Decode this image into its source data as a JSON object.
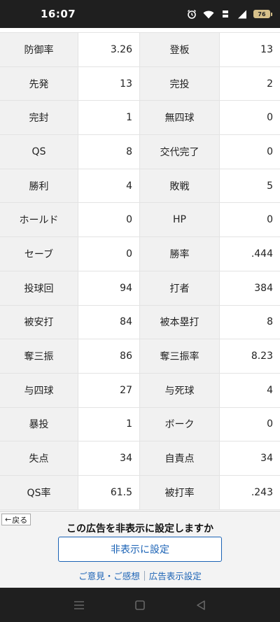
{
  "status_bar": {
    "time": "16:07",
    "battery_level": "76",
    "icons": [
      "alarm-icon",
      "wifi-icon",
      "volte-icon",
      "signal-icon",
      "battery-icon"
    ]
  },
  "stats": [
    {
      "l1": "防御率",
      "v1": "3.26",
      "l2": "登板",
      "v2": "13"
    },
    {
      "l1": "先発",
      "v1": "13",
      "l2": "完投",
      "v2": "2"
    },
    {
      "l1": "完封",
      "v1": "1",
      "l2": "無四球",
      "v2": "0"
    },
    {
      "l1": "QS",
      "v1": "8",
      "l2": "交代完了",
      "v2": "0"
    },
    {
      "l1": "勝利",
      "v1": "4",
      "l2": "敗戦",
      "v2": "5"
    },
    {
      "l1": "ホールド",
      "v1": "0",
      "l2": "HP",
      "v2": "0"
    },
    {
      "l1": "セーブ",
      "v1": "0",
      "l2": "勝率",
      "v2": ".444"
    },
    {
      "l1": "投球回",
      "v1": "94",
      "l2": "打者",
      "v2": "384"
    },
    {
      "l1": "被安打",
      "v1": "84",
      "l2": "被本塁打",
      "v2": "8"
    },
    {
      "l1": "奪三振",
      "v1": "86",
      "l2": "奪三振率",
      "v2": "8.23"
    },
    {
      "l1": "与四球",
      "v1": "27",
      "l2": "与死球",
      "v2": "4"
    },
    {
      "l1": "暴投",
      "v1": "1",
      "l2": "ボーク",
      "v2": "0"
    },
    {
      "l1": "失点",
      "v1": "34",
      "l2": "自責点",
      "v2": "34"
    },
    {
      "l1": "QS率",
      "v1": "61.5",
      "l2": "被打率",
      "v2": ".243"
    }
  ],
  "ad": {
    "back_label": "戻る",
    "title": "この広告を非表示に設定しますか",
    "hide_button": "非表示に設定",
    "feedback_link": "ご意見・ご感想",
    "settings_link": "広告表示設定"
  },
  "colors": {
    "link": "#1a62b5",
    "label_bg": "#f1f1f1",
    "bars": "#1f1f1f"
  }
}
